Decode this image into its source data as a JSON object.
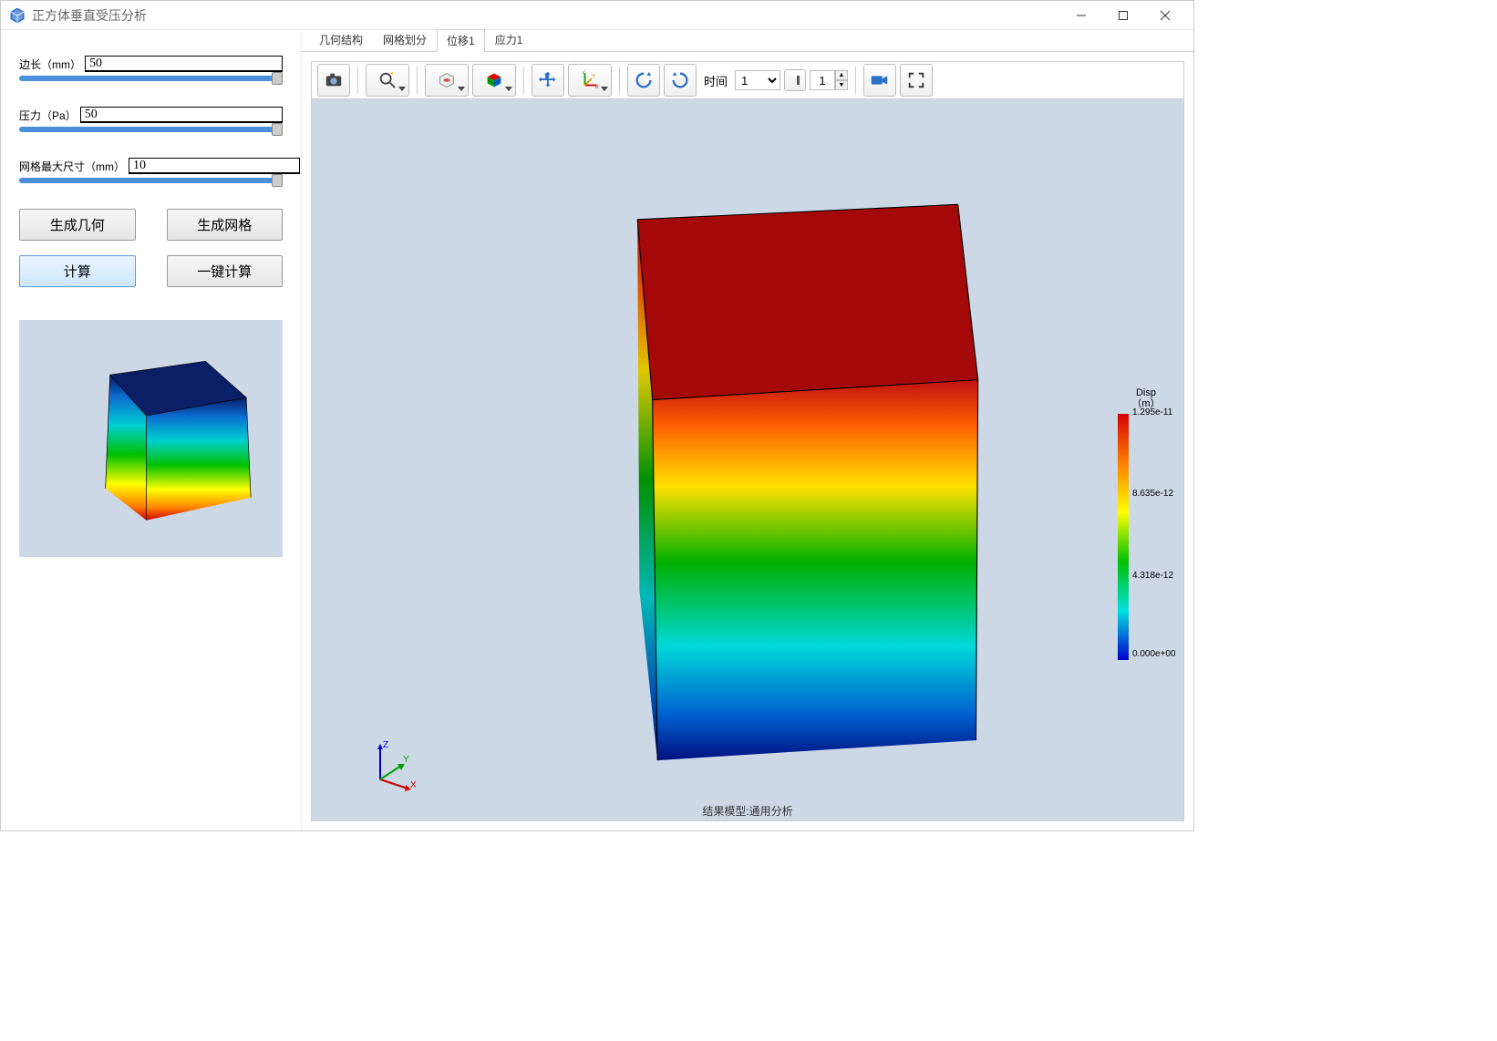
{
  "window": {
    "title": "正方体垂直受压分析"
  },
  "params": {
    "edge": {
      "label": "边长（mm）",
      "value": "50"
    },
    "pressure": {
      "label": "压力（Pa）",
      "value": "50"
    },
    "mesh": {
      "label": "网格最大尺寸（mm）",
      "value": "10"
    }
  },
  "buttons": {
    "gen_geom": "生成几何",
    "gen_mesh": "生成网格",
    "compute": "计算",
    "one_click": "一键计算"
  },
  "tabs": [
    {
      "label": "几何结构"
    },
    {
      "label": "网格划分"
    },
    {
      "label": "位移1",
      "active": true
    },
    {
      "label": "应力1"
    }
  ],
  "toolbar": {
    "icons": {
      "camera": "camera-icon",
      "zoom": "zoom-icon",
      "wire": "wireframe-icon",
      "cube": "cube-color-icon",
      "move": "move-icon",
      "axes": "axes-icon",
      "rot_ccw": "rotate-ccw-icon",
      "rot_cw": "rotate-cw-icon",
      "video": "video-icon",
      "fullscreen": "fullscreen-icon"
    },
    "time_label": "时间",
    "time_value": "1",
    "frame_value": "1"
  },
  "legend": {
    "title1": "Disp",
    "title2": "（m）",
    "ticks": [
      {
        "pos": 0,
        "label": "1.295e-11"
      },
      {
        "pos": 33,
        "label": "8.635e-12"
      },
      {
        "pos": 66,
        "label": "4.318e-12"
      },
      {
        "pos": 100,
        "label": "0.000e+00"
      }
    ]
  },
  "triad": {
    "x": "X",
    "y": "Y",
    "z": "Z"
  },
  "footer": "结果模型:通用分析"
}
